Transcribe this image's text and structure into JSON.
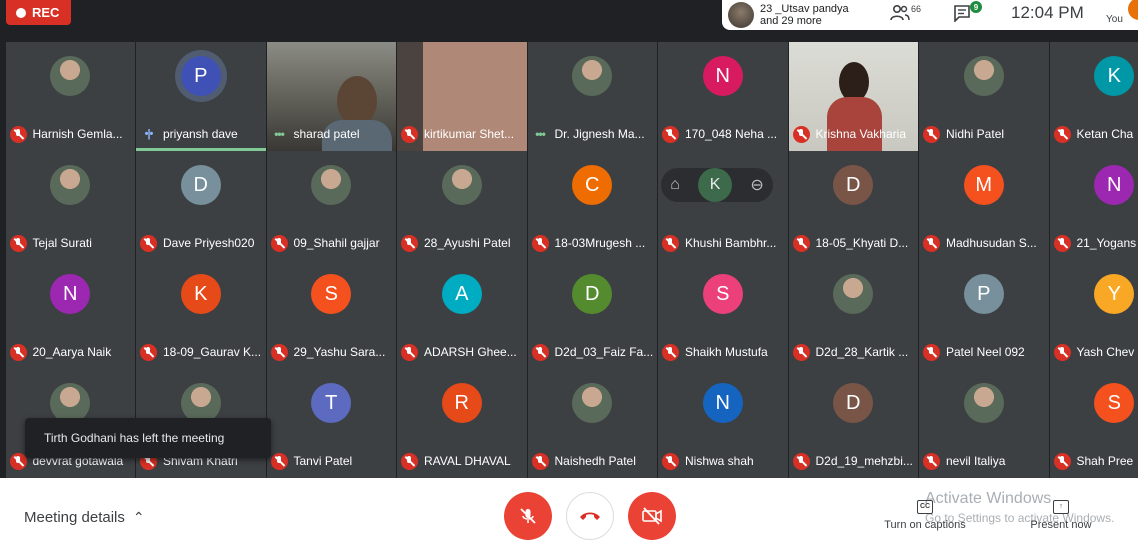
{
  "topbar": {
    "rec_label": "REC",
    "presenter_line1": "23 _Utsav pandya",
    "presenter_line2": "and 29 more",
    "people_count": "66",
    "chat_count": "9",
    "clock": "12:04 PM",
    "you_label": "You"
  },
  "participants": [
    {
      "name": "Harnish Gemla...",
      "avatar": "photo",
      "status": "muted"
    },
    {
      "name": "priyansh dave",
      "avatar": "letter",
      "letter": "P",
      "color": "#3f51b5",
      "status": "speaking"
    },
    {
      "name": "sharad patel",
      "avatar": "video1",
      "status": "active"
    },
    {
      "name": "kirtikumar Shet...",
      "avatar": "video2",
      "status": "muted"
    },
    {
      "name": "Dr. Jignesh Ma...",
      "avatar": "photo",
      "status": "active"
    },
    {
      "name": "170_048 Neha ...",
      "avatar": "letter",
      "letter": "N",
      "color": "#d81b60",
      "status": "muted"
    },
    {
      "name": "Krishna Vakharia",
      "avatar": "video3",
      "status": "muted"
    },
    {
      "name": "Nidhi Patel",
      "avatar": "photo",
      "status": "muted"
    },
    {
      "name": "Ketan Cha",
      "avatar": "letter",
      "letter": "K",
      "color": "#0097a7",
      "status": "muted"
    },
    {
      "name": "Tejal Surati",
      "avatar": "photo",
      "status": "muted"
    },
    {
      "name": "Dave Priyesh020",
      "avatar": "letter",
      "letter": "D",
      "color": "#78909c",
      "status": "muted"
    },
    {
      "name": "09_Shahil gajjar",
      "avatar": "photo",
      "status": "muted"
    },
    {
      "name": "28_Ayushi Patel",
      "avatar": "photo",
      "status": "muted"
    },
    {
      "name": "18-03Mrugesh ...",
      "avatar": "letter",
      "letter": "C",
      "color": "#ef6c00",
      "status": "muted"
    },
    {
      "name": "Khushi Bambhr...",
      "avatar": "hover",
      "letter": "K",
      "status": "muted"
    },
    {
      "name": "18-05_Khyati D...",
      "avatar": "letter",
      "letter": "D",
      "color": "#795548",
      "status": "muted"
    },
    {
      "name": "Madhusudan S...",
      "avatar": "letter",
      "letter": "M",
      "color": "#f4511e",
      "status": "muted"
    },
    {
      "name": "21_Yogans",
      "avatar": "letter",
      "letter": "N",
      "color": "#9c27b0",
      "status": "muted"
    },
    {
      "name": "20_Aarya Naik",
      "avatar": "letter",
      "letter": "N",
      "color": "#9c27b0",
      "status": "muted"
    },
    {
      "name": "18-09_Gaurav K...",
      "avatar": "letter",
      "letter": "K",
      "color": "#e64a19",
      "status": "muted"
    },
    {
      "name": "29_Yashu Sara...",
      "avatar": "letter",
      "letter": "S",
      "color": "#f4511e",
      "status": "muted"
    },
    {
      "name": "ADARSH Ghee...",
      "avatar": "letter",
      "letter": "A",
      "color": "#00acc1",
      "status": "muted"
    },
    {
      "name": "D2d_03_Faiz Fa...",
      "avatar": "letter",
      "letter": "D",
      "color": "#558b2f",
      "status": "muted"
    },
    {
      "name": "Shaikh Mustufa",
      "avatar": "letter",
      "letter": "S",
      "color": "#ec407a",
      "status": "muted"
    },
    {
      "name": "D2d_28_Kartik ...",
      "avatar": "photo",
      "status": "muted"
    },
    {
      "name": "Patel Neel 092",
      "avatar": "letter",
      "letter": "P",
      "color": "#78909c",
      "status": "muted"
    },
    {
      "name": "Yash Chev",
      "avatar": "letter",
      "letter": "Y",
      "color": "#f9a825",
      "status": "muted"
    },
    {
      "name": "devvrat gotawala",
      "avatar": "photo",
      "status": "muted"
    },
    {
      "name": "Shivam Khatri",
      "avatar": "photo",
      "status": "muted"
    },
    {
      "name": "Tanvi Patel",
      "avatar": "letter",
      "letter": "T",
      "color": "#5c6bc0",
      "status": "muted"
    },
    {
      "name": "RAVAL DHAVAL",
      "avatar": "letter",
      "letter": "R",
      "color": "#e64a19",
      "status": "muted"
    },
    {
      "name": "Naishedh Patel",
      "avatar": "photo",
      "status": "muted"
    },
    {
      "name": "Nishwa shah",
      "avatar": "letter",
      "letter": "N",
      "color": "#1565c0",
      "status": "muted"
    },
    {
      "name": "D2d_19_mehzbi...",
      "avatar": "letter",
      "letter": "D",
      "color": "#795548",
      "status": "muted"
    },
    {
      "name": "nevil Italiya",
      "avatar": "photo",
      "status": "muted"
    },
    {
      "name": "Shah Pree",
      "avatar": "letter",
      "letter": "S",
      "color": "#f4511e",
      "status": "muted"
    }
  ],
  "toast": "Tirth Godhani has left the meeting",
  "bottombar": {
    "meeting_details": "Meeting details",
    "captions_label": "Turn on captions",
    "captions_icon_text": "CC",
    "present_label": "Present now",
    "watermark_line1": "Activate Windows",
    "watermark_line2": "Go to Settings to activate Windows."
  }
}
